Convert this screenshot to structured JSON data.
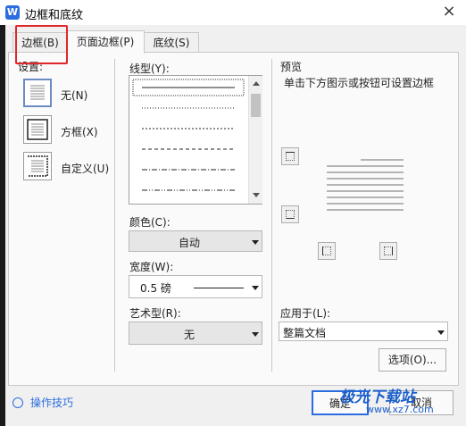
{
  "window": {
    "title": "边框和底纹",
    "app_icon": "W",
    "close": "×"
  },
  "tabs": [
    {
      "label": "边框(B)",
      "active": true
    },
    {
      "label": "页面边框(P)",
      "active": false
    },
    {
      "label": "底纹(S)",
      "active": false
    }
  ],
  "settings": {
    "heading": "设置:",
    "items": [
      {
        "label": "无(N)",
        "icon": "border-none-icon"
      },
      {
        "label": "方框(X)",
        "icon": "border-box-icon"
      },
      {
        "label": "自定义(U)",
        "icon": "border-custom-icon"
      }
    ]
  },
  "line_style": {
    "label": "线型(Y):",
    "styles": [
      "solid",
      "dotted",
      "dashed-small",
      "dashed",
      "dash-dot",
      "dash-dot-dot"
    ]
  },
  "color": {
    "label": "颜色(C):",
    "value": "自动"
  },
  "width": {
    "label": "宽度(W):",
    "value": "0.5 磅"
  },
  "art": {
    "label": "艺术型(R):",
    "value": "无"
  },
  "preview": {
    "heading": "预览",
    "hint": "单击下方图示或按钮可设置边框"
  },
  "apply_to": {
    "label": "应用于(L):",
    "value": "整篇文档"
  },
  "options_button": "选项(O)...",
  "tips": "操作技巧",
  "ok_button": "确定",
  "cancel_button": "取消",
  "watermark": {
    "brand": "极光下载站",
    "url": "www.xz7.com"
  }
}
